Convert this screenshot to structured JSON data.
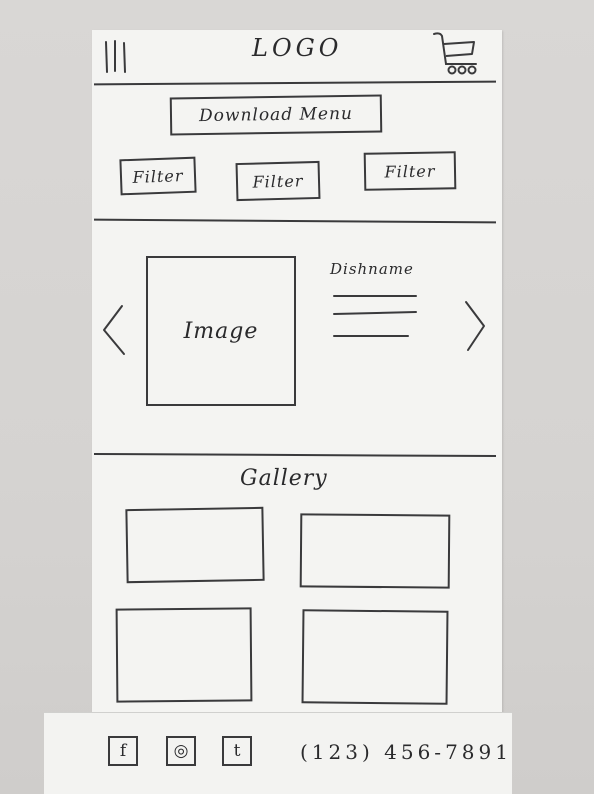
{
  "header": {
    "logo_text": "LOGO",
    "menu_icon": "hamburger-menu-icon",
    "cart_icon": "shopping-cart-icon"
  },
  "actions": {
    "download_menu_label": "Download Menu",
    "filters": [
      "Filter",
      "Filter",
      "Filter"
    ]
  },
  "featured": {
    "image_label": "Image",
    "dish_name": "Dishname",
    "prev_icon": "chevron-left-icon",
    "next_icon": "chevron-right-icon"
  },
  "gallery": {
    "title": "Gallery"
  },
  "footer": {
    "social": [
      {
        "icon": "facebook-icon",
        "glyph": "f"
      },
      {
        "icon": "instagram-icon",
        "glyph": "◎"
      },
      {
        "icon": "twitter-icon",
        "glyph": "t"
      }
    ],
    "phone": "(123) 456-7891"
  },
  "colors": {
    "ink": "#2a2a2c",
    "paper": "#f4f4f2",
    "background": "#d8d6d4"
  }
}
